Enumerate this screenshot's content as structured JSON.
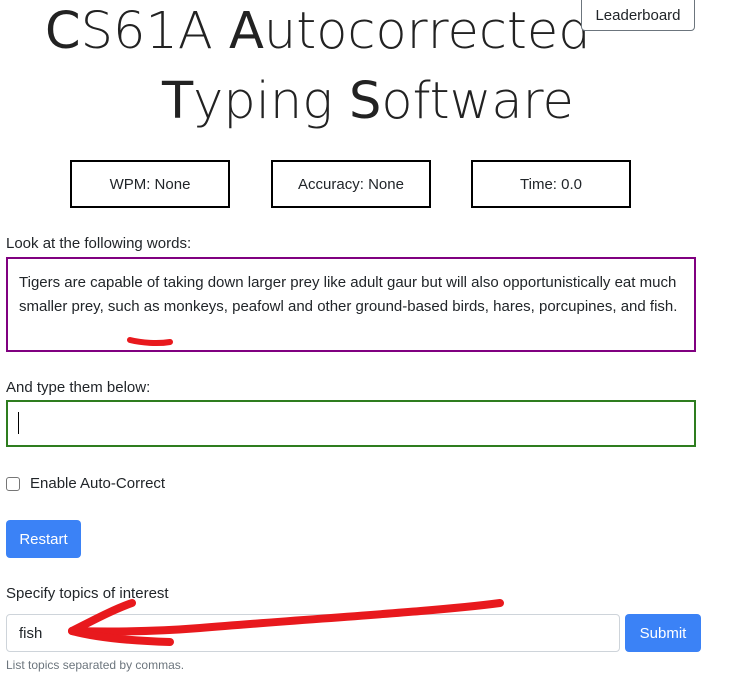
{
  "header": {
    "title_line_1": {
      "c_cap": "C",
      "c_rest": "S61A ",
      "a_cap": "A",
      "a_rest": "utocorrected"
    },
    "title_line_2": {
      "t_cap": "T",
      "t_rest": "yping ",
      "s_cap": "S",
      "s_rest": "oftware"
    },
    "leaderboard_label": "Leaderboard"
  },
  "stats": {
    "wpm": "WPM: None",
    "accuracy": "Accuracy: None",
    "time": "Time: 0.0"
  },
  "prompt": {
    "label": "Look at the following words:",
    "text": "Tigers are capable of taking down larger prey like adult gaur but will also opportunistically eat much smaller prey, such as monkeys, peafowl and other ground-based birds, hares, porcupines, and fish."
  },
  "typing": {
    "label": "And type them below:",
    "value": ""
  },
  "autocorrect": {
    "label": "Enable Auto-Correct",
    "checked": false
  },
  "restart_label": "Restart",
  "topics": {
    "label": "Specify topics of interest",
    "value": "fish",
    "submit_label": "Submit",
    "help": "List topics separated by commas."
  },
  "colors": {
    "accent": "#3b82f6",
    "prompt_border": "#800080",
    "input_border": "#2e7d1f",
    "annotation": "#e8191d"
  }
}
